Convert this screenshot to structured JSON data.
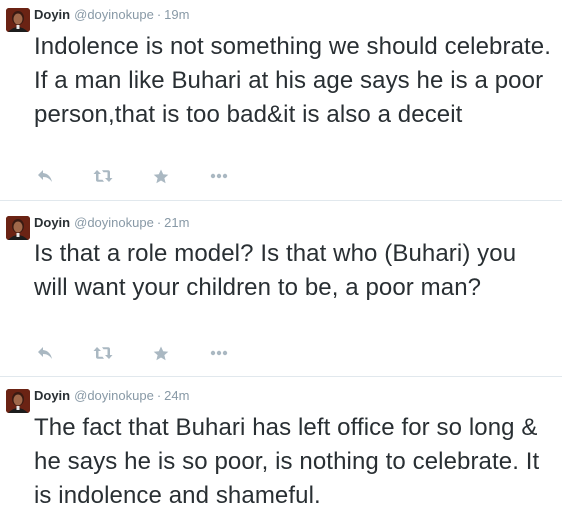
{
  "tweets": [
    {
      "fullname": "Doyin",
      "username": "@doyinokupe",
      "separator": "·",
      "time": "19m",
      "text": "Indolence is not something we should celebrate. If a man like Buhari at his age says he is a poor person,that is too bad&it is also a deceit",
      "actions": [
        "reply-icon",
        "retweet-icon",
        "favorite-icon",
        "more-icon"
      ]
    },
    {
      "fullname": "Doyin",
      "username": "@doyinokupe",
      "separator": "·",
      "time": "21m",
      "text": "Is that a role model? Is that who (Buhari) you will want your children to be, a poor man?",
      "actions": [
        "reply-icon",
        "retweet-icon",
        "favorite-icon",
        "more-icon"
      ]
    },
    {
      "fullname": "Doyin",
      "username": "@doyinokupe",
      "separator": "·",
      "time": "24m",
      "text": "The fact that Buhari has left office for so long & he says he is so poor, is nothing to celebrate. It is indolence and shameful."
    }
  ],
  "colors": {
    "text": "#292f33",
    "meta": "#8899a6",
    "icon": "#aab8c2",
    "divider": "#e1e8ed"
  }
}
